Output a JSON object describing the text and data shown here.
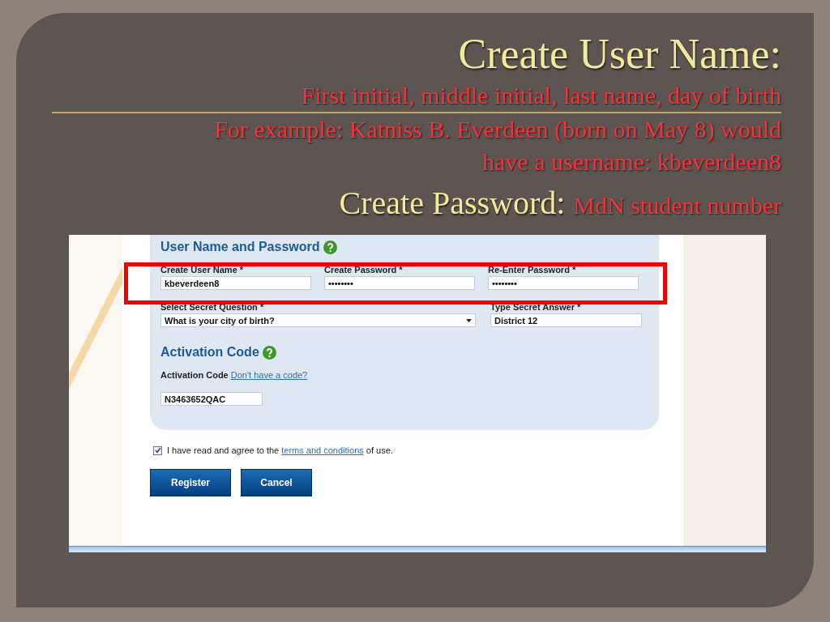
{
  "slide": {
    "heading": "Create User Name:",
    "notes": [
      "First initial, middle initial, last name, day of birth",
      "For example: Katniss B. Everdeen (born on May 8) would",
      "have a username:  kbeverdeen8"
    ],
    "password_heading": "Create Password:",
    "password_note": "MdN student number"
  },
  "form": {
    "section_title": "User Name and Password",
    "highlighted_fields": [
      {
        "label": "Create User Name *",
        "value": "kbeverdeen8"
      },
      {
        "label": "Create Password *",
        "value": "••••••••"
      },
      {
        "label": "Re-Enter Password *",
        "value": "••••••••"
      }
    ],
    "secret_question": {
      "label": "Select Secret Question *",
      "value": "What is your city of birth?"
    },
    "secret_answer": {
      "label": "Type Secret Answer *",
      "value": "District 12"
    },
    "activation_title": "Activation Code",
    "activation_label": "Activation Code",
    "activation_link": "Don't have a code?",
    "activation_value": "N3463652QAC",
    "agreement": {
      "checked": true,
      "before": "I have read and agree to the ",
      "link": "terms and conditions",
      "after": " of use."
    },
    "buttons": [
      "Register",
      "Cancel"
    ]
  }
}
